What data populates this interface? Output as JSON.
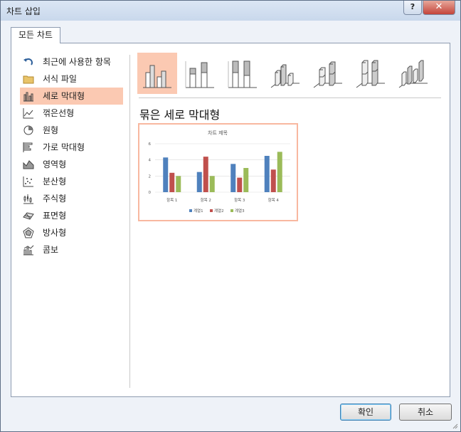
{
  "window": {
    "title": "차트 삽입",
    "help_label": "?",
    "close_label": "✕"
  },
  "tab": {
    "label": "모든 차트"
  },
  "sidebar": {
    "items": [
      {
        "label": "최근에 사용한 항목",
        "icon": "recent-icon"
      },
      {
        "label": "서식 파일",
        "icon": "folder-icon"
      },
      {
        "label": "세로 막대형",
        "icon": "column-chart-icon",
        "selected": true
      },
      {
        "label": "꺾은선형",
        "icon": "line-chart-icon"
      },
      {
        "label": "원형",
        "icon": "pie-chart-icon"
      },
      {
        "label": "가로 막대형",
        "icon": "bar-chart-icon"
      },
      {
        "label": "영역형",
        "icon": "area-chart-icon"
      },
      {
        "label": "분산형",
        "icon": "scatter-chart-icon"
      },
      {
        "label": "주식형",
        "icon": "stock-chart-icon"
      },
      {
        "label": "표면형",
        "icon": "surface-chart-icon"
      },
      {
        "label": "방사형",
        "icon": "radar-chart-icon"
      },
      {
        "label": "콤보",
        "icon": "combo-chart-icon"
      }
    ]
  },
  "main": {
    "heading": "묶은 세로 막대형"
  },
  "chart_data": {
    "type": "bar",
    "title": "차트 제목",
    "categories": [
      "항목 1",
      "항목 2",
      "항목 3",
      "항목 4"
    ],
    "series": [
      {
        "name": "계열1",
        "values": [
          4.3,
          2.5,
          3.5,
          4.5
        ],
        "color": "#4f81bd"
      },
      {
        "name": "계열2",
        "values": [
          2.4,
          4.4,
          1.8,
          2.8
        ],
        "color": "#c0504d"
      },
      {
        "name": "계열3",
        "values": [
          2.0,
          2.0,
          3.0,
          5.0
        ],
        "color": "#9bbb59"
      }
    ],
    "ylim": [
      0,
      6
    ],
    "yticks": [
      0,
      2,
      4,
      6
    ],
    "grid": true,
    "legend": "bottom"
  },
  "footer": {
    "ok_label": "확인",
    "cancel_label": "취소"
  }
}
